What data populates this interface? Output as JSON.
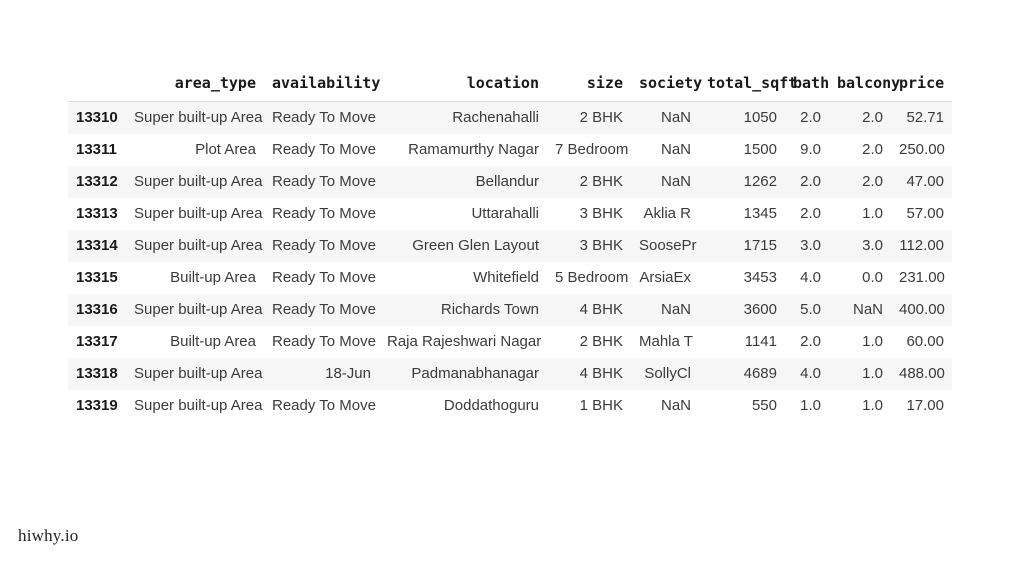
{
  "table": {
    "index_header": "",
    "columns": [
      "area_type",
      "availability",
      "location",
      "size",
      "society",
      "total_sqft",
      "bath",
      "balcony",
      "price"
    ],
    "rows": [
      {
        "index": "13310",
        "area_type": "Super built-up Area",
        "availability": "Ready To Move",
        "location": "Rachenahalli",
        "size": "2 BHK",
        "society": "NaN",
        "total_sqft": "1050",
        "bath": "2.0",
        "balcony": "2.0",
        "price": "52.71"
      },
      {
        "index": "13311",
        "area_type": "Plot Area",
        "availability": "Ready To Move",
        "location": "Ramamurthy Nagar",
        "size": "7 Bedroom",
        "society": "NaN",
        "total_sqft": "1500",
        "bath": "9.0",
        "balcony": "2.0",
        "price": "250.00"
      },
      {
        "index": "13312",
        "area_type": "Super built-up Area",
        "availability": "Ready To Move",
        "location": "Bellandur",
        "size": "2 BHK",
        "society": "NaN",
        "total_sqft": "1262",
        "bath": "2.0",
        "balcony": "2.0",
        "price": "47.00"
      },
      {
        "index": "13313",
        "area_type": "Super built-up Area",
        "availability": "Ready To Move",
        "location": "Uttarahalli",
        "size": "3 BHK",
        "society": "Aklia R",
        "total_sqft": "1345",
        "bath": "2.0",
        "balcony": "1.0",
        "price": "57.00"
      },
      {
        "index": "13314",
        "area_type": "Super built-up Area",
        "availability": "Ready To Move",
        "location": "Green Glen Layout",
        "size": "3 BHK",
        "society": "SoosePr",
        "total_sqft": "1715",
        "bath": "3.0",
        "balcony": "3.0",
        "price": "112.00"
      },
      {
        "index": "13315",
        "area_type": "Built-up Area",
        "availability": "Ready To Move",
        "location": "Whitefield",
        "size": "5 Bedroom",
        "society": "ArsiaEx",
        "total_sqft": "3453",
        "bath": "4.0",
        "balcony": "0.0",
        "price": "231.00"
      },
      {
        "index": "13316",
        "area_type": "Super built-up Area",
        "availability": "Ready To Move",
        "location": "Richards Town",
        "size": "4 BHK",
        "society": "NaN",
        "total_sqft": "3600",
        "bath": "5.0",
        "balcony": "NaN",
        "price": "400.00"
      },
      {
        "index": "13317",
        "area_type": "Built-up Area",
        "availability": "Ready To Move",
        "location": "Raja Rajeshwari Nagar",
        "size": "2 BHK",
        "society": "Mahla T",
        "total_sqft": "1141",
        "bath": "2.0",
        "balcony": "1.0",
        "price": "60.00"
      },
      {
        "index": "13318",
        "area_type": "Super built-up Area",
        "availability": "18-Jun",
        "location": "Padmanabhanagar",
        "size": "4 BHK",
        "society": "SollyCl",
        "total_sqft": "4689",
        "bath": "4.0",
        "balcony": "1.0",
        "price": "488.00"
      },
      {
        "index": "13319",
        "area_type": "Super built-up Area",
        "availability": "Ready To Move",
        "location": "Doddathoguru",
        "size": "1 BHK",
        "society": "NaN",
        "total_sqft": "550",
        "bath": "1.0",
        "balcony": "1.0",
        "price": "17.00"
      }
    ]
  },
  "watermark": {
    "text": "hiwhy.io"
  },
  "colors": {
    "stripe": "#f6f6f7",
    "background": "#ffffff",
    "header_rule": "#dcdcdc",
    "body_text": "#3b3b3b",
    "header_text": "#1a1a1a"
  }
}
